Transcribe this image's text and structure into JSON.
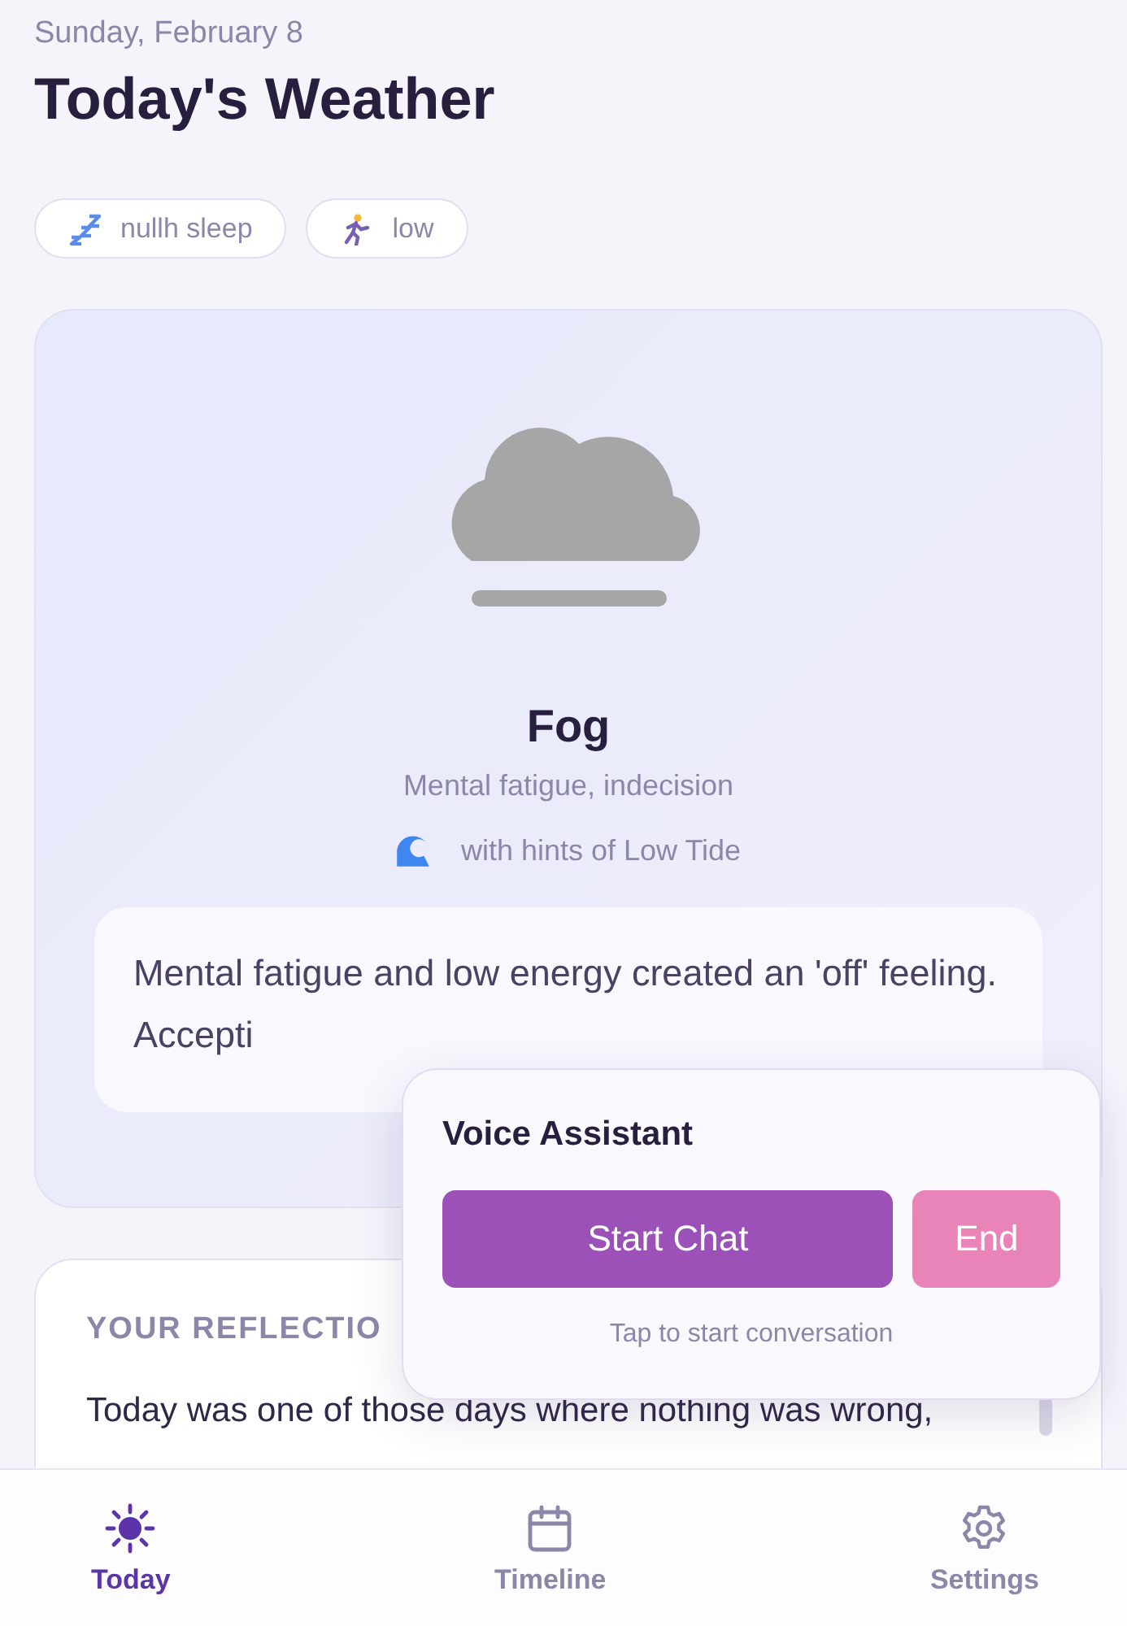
{
  "header": {
    "date": "Sunday, February 8",
    "title": "Today's Weather"
  },
  "chips": [
    {
      "kind": "sleep",
      "label": "nullh sleep"
    },
    {
      "kind": "energy",
      "label": "low"
    }
  ],
  "weather": {
    "name": "Fog",
    "description": "Mental fatigue, indecision",
    "hint": "with hints of Low Tide",
    "note": "Mental fatigue and low energy created an 'off' feeling. Accepti"
  },
  "reflection": {
    "heading": "YOUR REFLECTIO",
    "text": "Today was one of those days where nothing was wrong,"
  },
  "voice_assistant": {
    "title": "Voice Assistant",
    "buttons": [
      {
        "kind": "primary",
        "label": "Start Chat"
      },
      {
        "kind": "end",
        "label": "End"
      }
    ],
    "hint": "Tap to start conversation"
  },
  "nav": [
    {
      "kind": "today",
      "label": "Today",
      "selected": true
    },
    {
      "kind": "timeline",
      "label": "Timeline",
      "selected": false
    },
    {
      "kind": "settings",
      "label": "Settings",
      "selected": false
    }
  ]
}
